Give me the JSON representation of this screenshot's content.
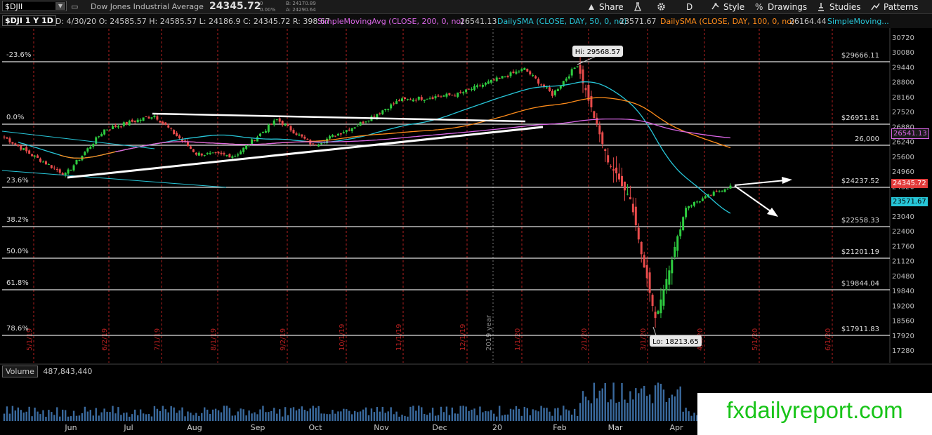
{
  "header": {
    "symbol": "$DJII",
    "description": "Dow Jones Industrial Average",
    "last": "24345.72",
    "change": "0",
    "change_pct": "0.00%",
    "bid": "B: 24170.89",
    "ask": "A: 24290.64"
  },
  "toolbar": {
    "share": "Share",
    "timeframe": "D",
    "style": "Style",
    "drawings": "Drawings",
    "studies": "Studies",
    "patterns": "Patterns"
  },
  "study_bar": {
    "period": "$DJI 1 Y 1D",
    "ohlc": "D: 4/30/20  O: 24585.57  H: 24585.57  L: 24186.9  C: 24345.72  R: 398.67",
    "sma200": "SimpleMovingAvg (CLOSE, 200, 0, no)",
    "sma200_val": "26541.13",
    "sma50": "DailySMA (CLOSE, DAY, 50, 0, no)",
    "sma50_val": "23571.67",
    "sma100": "DailySMA (CLOSE, DAY, 100, 0, no)",
    "sma100_val": "26164.44",
    "more": "SimpleMoving..."
  },
  "price_axis": [
    "30720",
    "30080",
    "29440",
    "28800",
    "28160",
    "27520",
    "26880",
    "26240",
    "25600",
    "24960",
    "24320",
    "23680",
    "23040",
    "22400",
    "21760",
    "21120",
    "20480",
    "19840",
    "19200",
    "18560",
    "17920",
    "17280"
  ],
  "fib_levels": [
    {
      "pct": "-23.6%",
      "value": "$29666.11"
    },
    {
      "pct": "0.0%",
      "value": "$26951.81"
    },
    {
      "pct": "",
      "value": "26,000"
    },
    {
      "pct": "23.6%",
      "value": "$24237.52"
    },
    {
      "pct": "38.2%",
      "value": "$22558.33"
    },
    {
      "pct": "50.0%",
      "value": "$21201.19"
    },
    {
      "pct": "61.8%",
      "value": "$19844.04"
    },
    {
      "pct": "78.6%",
      "value": "$17911.83"
    }
  ],
  "markers": {
    "hi": "Hi: 29568.57",
    "lo": "Lo: 18213.65"
  },
  "price_labels": {
    "sma200": "26541.13",
    "last": "24345.72",
    "sma50": "23571.67"
  },
  "date_markers": [
    "5/1/19",
    "6/2/19",
    "7/1/19",
    "8/1/19",
    "9/2/19",
    "10/1/19",
    "11/1/19",
    "12/1/19",
    "1/1/20",
    "2/1/20",
    "3/1/20",
    "4/1/20",
    "5/1/20",
    "6/1/20"
  ],
  "year_marker": "2019 year",
  "volume": {
    "label": "Volume",
    "value": "487,843,440"
  },
  "months": [
    "Jun",
    "Jul",
    "Aug",
    "Sep",
    "Oct",
    "Nov",
    "Dec",
    "20",
    "Feb",
    "Mar",
    "Apr"
  ],
  "watermark": "fxdailyreport.com",
  "colors": {
    "up": "#2ecc40",
    "down": "#e94b4b",
    "sma50": "#27c6d8",
    "sma100": "#ff8c1a",
    "sma200": "#d966e6",
    "trendline": "#ffffff",
    "date_marker": "#b21f1f"
  },
  "chart_data": {
    "type": "candlestick",
    "symbol": "$DJI",
    "ylim": [
      17000,
      31000
    ],
    "close_path": [
      [
        "2019-05-01",
        26430
      ],
      [
        "2019-05-15",
        25650
      ],
      [
        "2019-06-01",
        24815
      ],
      [
        "2019-06-20",
        26750
      ],
      [
        "2019-07-15",
        27360
      ],
      [
        "2019-08-05",
        25720
      ],
      [
        "2019-08-25",
        25630
      ],
      [
        "2019-09-15",
        27180
      ],
      [
        "2019-10-03",
        26080
      ],
      [
        "2019-10-25",
        26950
      ],
      [
        "2019-11-15",
        28000
      ],
      [
        "2019-12-15",
        28270
      ],
      [
        "2020-01-17",
        29350
      ],
      [
        "2020-01-31",
        28260
      ],
      [
        "2020-02-12",
        29550
      ],
      [
        "2020-02-28",
        25400
      ],
      [
        "2020-03-10",
        23800
      ],
      [
        "2020-03-23",
        18590
      ],
      [
        "2020-04-08",
        23430
      ],
      [
        "2020-04-30",
        24345
      ]
    ]
  }
}
